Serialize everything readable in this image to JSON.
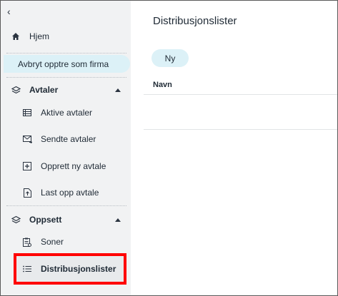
{
  "nav": {
    "back_glyph": "‹",
    "home_label": "Hjem",
    "stop_acting_label": "Avbryt opptre som firma",
    "sections": [
      {
        "label": "Avtaler",
        "items": [
          {
            "label": "Aktive avtaler",
            "icon": "list-icon"
          },
          {
            "label": "Sendte avtaler",
            "icon": "mail-send-icon"
          },
          {
            "label": "Opprett ny avtale",
            "icon": "plus-box-icon"
          },
          {
            "label": "Last opp avtale",
            "icon": "file-upload-icon"
          }
        ]
      },
      {
        "label": "Oppsett",
        "items": [
          {
            "label": "Soner",
            "icon": "clipboard-icon"
          },
          {
            "label": "Distribusjonslister",
            "icon": "list-lines-icon",
            "active": true
          }
        ]
      }
    ]
  },
  "main": {
    "title": "Distribusjonslister",
    "new_button": "Ny",
    "columns": [
      "Navn"
    ]
  },
  "colors": {
    "accent_pill": "#dcf1f7",
    "sidebar_bg": "#f1f2f3",
    "highlight": "#ff0000"
  }
}
